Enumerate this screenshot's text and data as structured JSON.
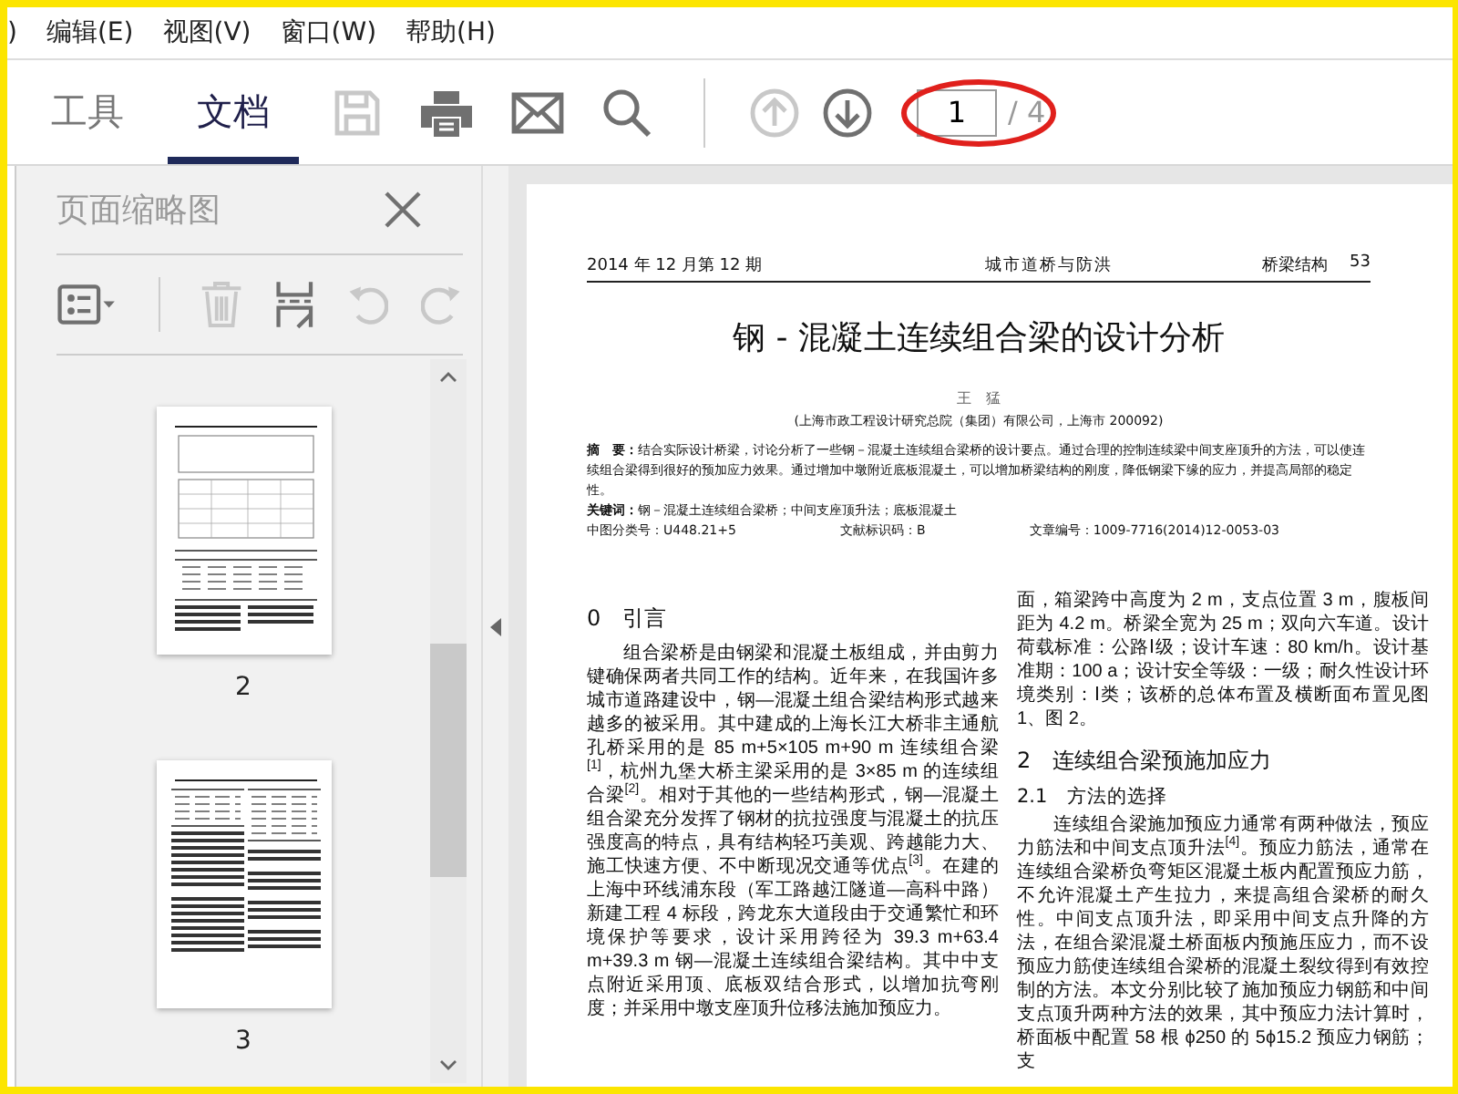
{
  "menu_bar": {
    "items": [
      ")",
      "编辑(E)",
      "视图(V)",
      "窗口(W)",
      "帮助(H)"
    ]
  },
  "tabs": [
    {
      "label": "工具",
      "selected": false
    },
    {
      "label": "文档",
      "selected": true
    }
  ],
  "toolbar": {
    "buttons": [
      {
        "kind": "save",
        "disabled": true
      },
      {
        "kind": "print",
        "disabled": false
      },
      {
        "kind": "mail",
        "disabled": false
      },
      {
        "kind": "search",
        "disabled": false
      },
      {
        "kind": "divider"
      },
      {
        "kind": "up",
        "disabled": true
      },
      {
        "kind": "down",
        "disabled": false
      }
    ],
    "page_field": {
      "value": "1"
    },
    "page_total": "/ 4"
  },
  "thumbnail_panel": {
    "title": "页面缩略图",
    "tools": [
      {
        "kind": "options",
        "disabled": false
      },
      {
        "kind": "divider"
      },
      {
        "kind": "delete",
        "disabled": true
      },
      {
        "kind": "insert",
        "disabled": false
      },
      {
        "kind": "undo",
        "disabled": true
      },
      {
        "kind": "redo",
        "disabled": true
      }
    ],
    "pages": [
      {
        "label": "2",
        "kind": "figures"
      },
      {
        "label": "3",
        "kind": "tables"
      }
    ]
  },
  "document": {
    "header": {
      "issue": "2014 年 12 月第 12 期",
      "journal": "城市道桥与防洪",
      "section": "桥梁结构",
      "page": "53"
    },
    "title": "钢 -  混凝土连续组合梁的设计分析",
    "author": "王　猛",
    "affiliation": "(上海市政工程设计研究总院（集团）有限公司，上海市  200092)",
    "abstract": "**摘　要：**结合实际设计桥梁，讨论分析了一些钢－混凝土连续组合梁桥的设计要点。通过合理的控制连续梁中间支座顶升的方法，可以使连续组合梁得到很好的预加应力效果。通过增加中墩附近底板混凝土，可以增加桥梁结构的刚度，降低钢梁下缘的应力，并提高局部的稳定性。",
    "keywords": "**关键词：**钢－混凝土连续组合梁桥；中间支座顶升法；底板混凝土",
    "classification": [
      "中图分类号：U448.21+5",
      "文献标识码：B",
      "文章编号：1009-7716(2014)12-0053-03"
    ],
    "left_column": [
      {
        "kind": "heading",
        "text": "0　引言"
      },
      {
        "kind": "paragraph",
        "text": "组合梁桥是由钢梁和混凝土板组成，并由剪力键确保两者共同工作的结构。近年来，在我国许多城市道路建设中，钢—混凝土组合梁结构形式越来越多的被采用。其中建成的上海长江大桥非主通航孔桥采用的是 85 m+5×105 m+90 m 连续组合梁$^{[1]}$，杭州九堡大桥主梁采用的是 3×85 m 的连续组合梁$^{[2]}$。相对于其他的一些结构形式，钢—混凝土组合梁充分发挥了钢材的抗拉强度与混凝土的抗压强度高的特点，具有结构轻巧美观、跨越能力大、施工快速方便、不中断现况交通等优点$^{[3]}$。在建的上海中环线浦东段（军工路越江隧道—高科中路）新建工程 4 标段，跨龙东大道段由于交通繁忙和环境保护等要求，设计采用跨径为 39.3 m+63.4 m+39.3 m 钢—混凝土连续组合梁结构。其中中支点附近采用顶、底板双结合形式，以增加抗弯刚度；并采用中墩支座顶升位移法施加预应力。"
      }
    ],
    "right_column": [
      {
        "kind": "continuation",
        "text": "面，箱梁跨中高度为 2 m，支点位置 3 m，腹板间距为 4.2 m。桥梁全宽为 25 m；双向六车道。设计荷载标准：公路Ⅰ级；设计车速：80 km/h。设计基准期：100 a；设计安全等级：一级；耐久性设计环境类别：Ⅰ类；该桥的总体布置及横断面布置见图 1、图 2。"
      },
      {
        "kind": "heading",
        "text": "2　连续组合梁预施加应力"
      },
      {
        "kind": "subheading",
        "text": "2.1　方法的选择"
      },
      {
        "kind": "paragraph",
        "text": "连续组合梁施加预应力通常有两种做法，预应力筋法和中间支点顶升法$^{[4]}$。预应力筋法，通常在连续组合梁桥负弯矩区混凝土板内配置预应力筋，不允许混凝土产生拉力，来提高组合梁桥的耐久性。中间支点顶升法，即采用中间支点升降的方法，在组合梁混凝土桥面板内预施压应力，而不设预应力筋使连续组合梁桥的混凝土裂纹得到有效控制的方法。本文分别比较了施加预应力钢筋和中间支点顶升两种方法的效果，其中预应力法计算时，桥面板中配置 58 根 ϕ250 的 5ϕ15.2 预应力钢筋；支"
      }
    ]
  }
}
